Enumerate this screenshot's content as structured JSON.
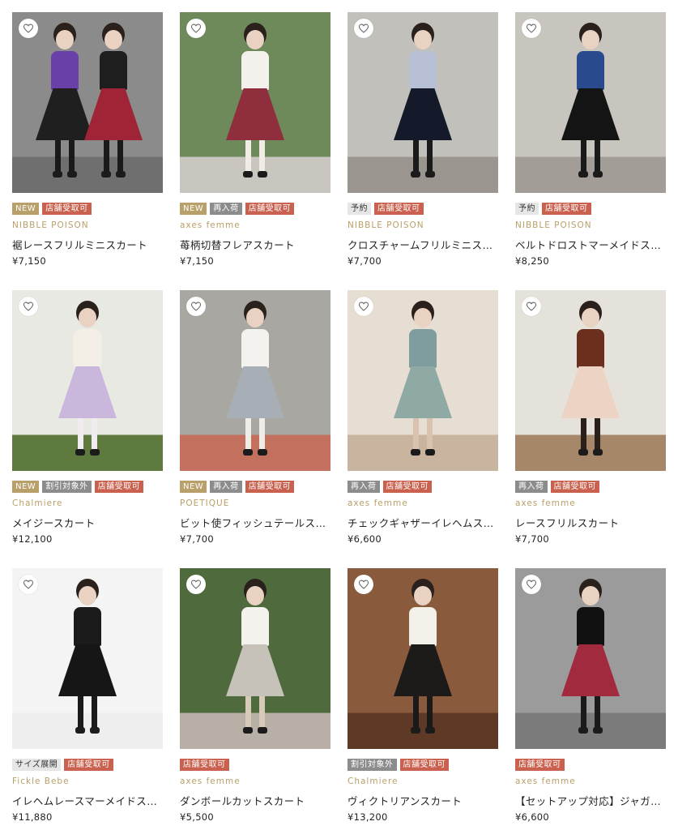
{
  "colors": {
    "badge_new": "#b9a06a",
    "badge_gray": "#8c8c8c",
    "badge_store": "#c9614e",
    "brand": "#b9a06a"
  },
  "icons": {
    "favorite": "heart-outline-icon"
  },
  "products": [
    {
      "badges": [
        {
          "label": "NEW",
          "kind": "new"
        },
        {
          "label": "店舗受取可",
          "kind": "store"
        }
      ],
      "brand": "NIBBLE POISON",
      "name": "裾レースフリルミニスカート",
      "price": "¥7,150",
      "bg": "#8b8b8b",
      "floor": "#6f6f6f",
      "top": "#6a3fa8",
      "skirt": "#1f1f1f",
      "legs": "#1a1a1a",
      "second": {
        "top": "#1e1e1e",
        "skirt": "#9e2436"
      }
    },
    {
      "badges": [
        {
          "label": "NEW",
          "kind": "new"
        },
        {
          "label": "再入荷",
          "kind": "gray"
        },
        {
          "label": "店舗受取可",
          "kind": "store"
        }
      ],
      "brand": "axes femme",
      "name": "苺柄切替フレアスカート",
      "price": "¥7,150",
      "bg": "#6e8a5a",
      "floor": "#c9c6c0",
      "top": "#f4f1ec",
      "skirt": "#8f2f3e",
      "legs": "#f2ece6"
    },
    {
      "badges": [
        {
          "label": "予約",
          "kind": "light"
        },
        {
          "label": "店舗受取可",
          "kind": "store"
        }
      ],
      "brand": "NIBBLE POISON",
      "name": "クロスチャームフリルミニスカート",
      "price": "¥7,700",
      "bg": "#c2c0ba",
      "floor": "#9a968f",
      "top": "#b8c0d6",
      "skirt": "#141a2a",
      "legs": "#1a1a1a"
    },
    {
      "badges": [
        {
          "label": "予約",
          "kind": "light"
        },
        {
          "label": "店舗受取可",
          "kind": "store"
        }
      ],
      "brand": "NIBBLE POISON",
      "name": "ベルトドロストマーメイドスカート",
      "price": "¥8,250",
      "bg": "#c8c5bf",
      "floor": "#a29e97",
      "top": "#2a4a8e",
      "skirt": "#141414",
      "legs": "#1a1a1a"
    },
    {
      "badges": [
        {
          "label": "NEW",
          "kind": "new"
        },
        {
          "label": "割引対象外",
          "kind": "gray"
        },
        {
          "label": "店舗受取可",
          "kind": "store"
        }
      ],
      "brand": "Chalmiere",
      "name": "メイジースカート",
      "price": "¥12,100",
      "bg": "#e9e9e4",
      "floor": "#5f7a3e",
      "top": "#f3efe7",
      "skirt": "#c9b7dc",
      "legs": "#f1ecf2"
    },
    {
      "badges": [
        {
          "label": "NEW",
          "kind": "new"
        },
        {
          "label": "再入荷",
          "kind": "gray"
        },
        {
          "label": "店舗受取可",
          "kind": "store"
        }
      ],
      "brand": "POETIQUE",
      "name": "ビット使フィッシュテールスカート",
      "price": "¥7,700",
      "bg": "#a9a7a2",
      "floor": "#c3705e",
      "top": "#f4f2ee",
      "skirt": "#a8aeb6",
      "legs": "#f0ece6"
    },
    {
      "badges": [
        {
          "label": "再入荷",
          "kind": "gray"
        },
        {
          "label": "店舗受取可",
          "kind": "store"
        }
      ],
      "brand": "axes femme",
      "name": "チェックギャザーイレヘムスカート",
      "price": "¥6,600",
      "bg": "#e6ddd3",
      "floor": "#c9b4a0",
      "top": "#7f9c9e",
      "skirt": "#8fa9a5",
      "legs": "#d9c3b0"
    },
    {
      "badges": [
        {
          "label": "再入荷",
          "kind": "gray"
        },
        {
          "label": "店舗受取可",
          "kind": "store"
        }
      ],
      "brand": "axes femme",
      "name": "レースフリルスカート",
      "price": "¥7,700",
      "bg": "#e5e2dc",
      "floor": "#a7876a",
      "top": "#6b2f1e",
      "skirt": "#ecd3c4",
      "legs": "#2b1f1a"
    },
    {
      "badges": [
        {
          "label": "サイズ展開",
          "kind": "light"
        },
        {
          "label": "店舗受取可",
          "kind": "store"
        }
      ],
      "brand": "Fickle Bebe",
      "name": "イレヘムレースマーメイドスカート",
      "price": "¥11,880",
      "bg": "#f4f4f4",
      "floor": "#eeeeee",
      "top": "#1b1b1b",
      "skirt": "#161616",
      "legs": "#1a1a1a"
    },
    {
      "badges": [
        {
          "label": "店舗受取可",
          "kind": "store"
        }
      ],
      "brand": "axes femme",
      "name": "ダンボールカットスカート",
      "price": "¥5,500",
      "bg": "#4f6a3c",
      "floor": "#b8b0a6",
      "top": "#f4f2ed",
      "skirt": "#c6c1b9",
      "legs": "#d8cab8"
    },
    {
      "badges": [
        {
          "label": "割引対象外",
          "kind": "gray"
        },
        {
          "label": "店舗受取可",
          "kind": "store"
        }
      ],
      "brand": "Chalmiere",
      "name": "ヴィクトリアンスカート",
      "price": "¥13,200",
      "bg": "#8a5a3c",
      "floor": "#5e3a26",
      "top": "#f3efe9",
      "skirt": "#1d1a1a",
      "legs": "#1a1a1a"
    },
    {
      "badges": [
        {
          "label": "店舗受取可",
          "kind": "store"
        }
      ],
      "brand": "axes femme",
      "name": "【セットアップ対応】ジャガードスカート",
      "price": "¥6,600",
      "bg": "#9b9b9b",
      "floor": "#7b7b7b",
      "top": "#111111",
      "skirt": "#a12a3e",
      "legs": "#1a1a1a"
    }
  ]
}
